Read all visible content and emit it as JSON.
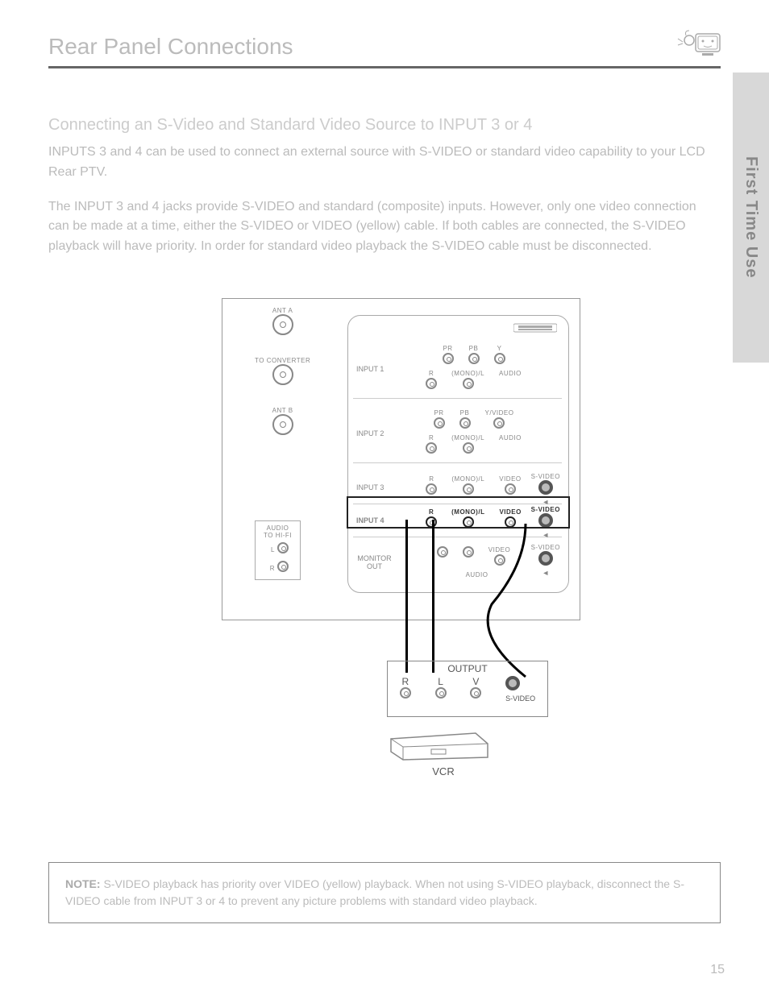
{
  "page": {
    "number": "15",
    "title": "Rear Panel Connections"
  },
  "sidebar": {
    "text": "First Time Use"
  },
  "intro": {
    "subhead": "Connecting an S-Video and Standard Video Source to INPUT 3 or 4",
    "p1": "INPUTS 3 and 4 can be used to connect an external source with S-VIDEO or standard video capability to your LCD Rear PTV.",
    "p2": "The INPUT 3 and 4 jacks provide S-VIDEO and standard (composite) inputs. However, only one video connection can be made at a time, either the S-VIDEO or VIDEO (yellow) cable. If both cables are connected, the S-VIDEO playback will have priority. In order for standard video playback the S-VIDEO cable must be disconnected."
  },
  "diagram": {
    "ant": {
      "a": "ANT A",
      "conv": "TO CONVERTER",
      "b": "ANT B"
    },
    "hifi": {
      "title_1": "AUDIO",
      "title_2": "TO HI-FI",
      "l": "L",
      "r": "R"
    },
    "inputs": {
      "row1": {
        "name": "INPUT 1",
        "pr": "PR",
        "pb": "PB",
        "y": "Y",
        "r": "R",
        "mono": "(MONO)/L",
        "audio": "AUDIO"
      },
      "row2": {
        "name": "INPUT 2",
        "pr": "PR",
        "pb": "PB",
        "yv": "Y/VIDEO",
        "r": "R",
        "mono": "(MONO)/L",
        "audio": "AUDIO"
      },
      "row3": {
        "name": "INPUT 3",
        "r": "R",
        "mono": "(MONO)/L",
        "video": "VIDEO",
        "sv": "S-VIDEO"
      },
      "row4": {
        "name": "INPUT 4",
        "r": "R",
        "mono": "(MONO)/L",
        "video": "VIDEO",
        "sv": "S-VIDEO"
      },
      "mon": {
        "name": "MONITOR OUT",
        "video": "VIDEO",
        "sv": "S-VIDEO",
        "audio": "AUDIO"
      }
    }
  },
  "vcr": {
    "panel_title": "OUTPUT",
    "r": "R",
    "l": "L",
    "v": "V",
    "sv": "S-VIDEO",
    "label": "VCR"
  },
  "note": {
    "lead": "NOTE:",
    "body": "S-VIDEO playback has priority over VIDEO (yellow) playback. When not using S-VIDEO playback, disconnect the S-VIDEO cable from INPUT 3 or 4 to prevent any picture problems with standard video playback."
  }
}
